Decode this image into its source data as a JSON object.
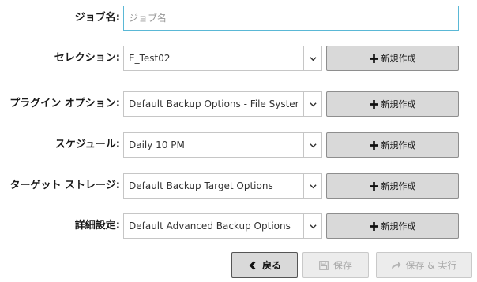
{
  "form": {
    "job_name": {
      "label": "ジョブ名:",
      "value": "",
      "placeholder": "ジョブ名"
    },
    "rows": [
      {
        "label": "セレクション:",
        "value": "E_Test02",
        "new_label": "新規作成"
      },
      {
        "label": "プラグイン オプション:",
        "value": "Default Backup Options - File System - ...",
        "new_label": "新規作成"
      },
      {
        "label": "スケジュール:",
        "value": "Daily 10 PM",
        "new_label": "新規作成"
      },
      {
        "label": "ターゲット ストレージ:",
        "value": "Default Backup Target Options",
        "new_label": "新規作成"
      },
      {
        "label": "詳細設定:",
        "value": "Default Advanced Backup Options",
        "new_label": "新規作成"
      }
    ]
  },
  "footer": {
    "back_label": "戻る",
    "save_label": "保存",
    "save_run_label": "保存 & 実行"
  },
  "colors": {
    "focus_border": "#5ab8d6",
    "button_bg": "#d9d9d9",
    "disabled_text": "#a9a9a9"
  },
  "icons": {
    "dropdown": "chevron-down-icon",
    "new": "plus-icon",
    "back": "chevron-left-icon",
    "save": "floppy-disk-icon",
    "save_run": "share-arrow-icon"
  }
}
